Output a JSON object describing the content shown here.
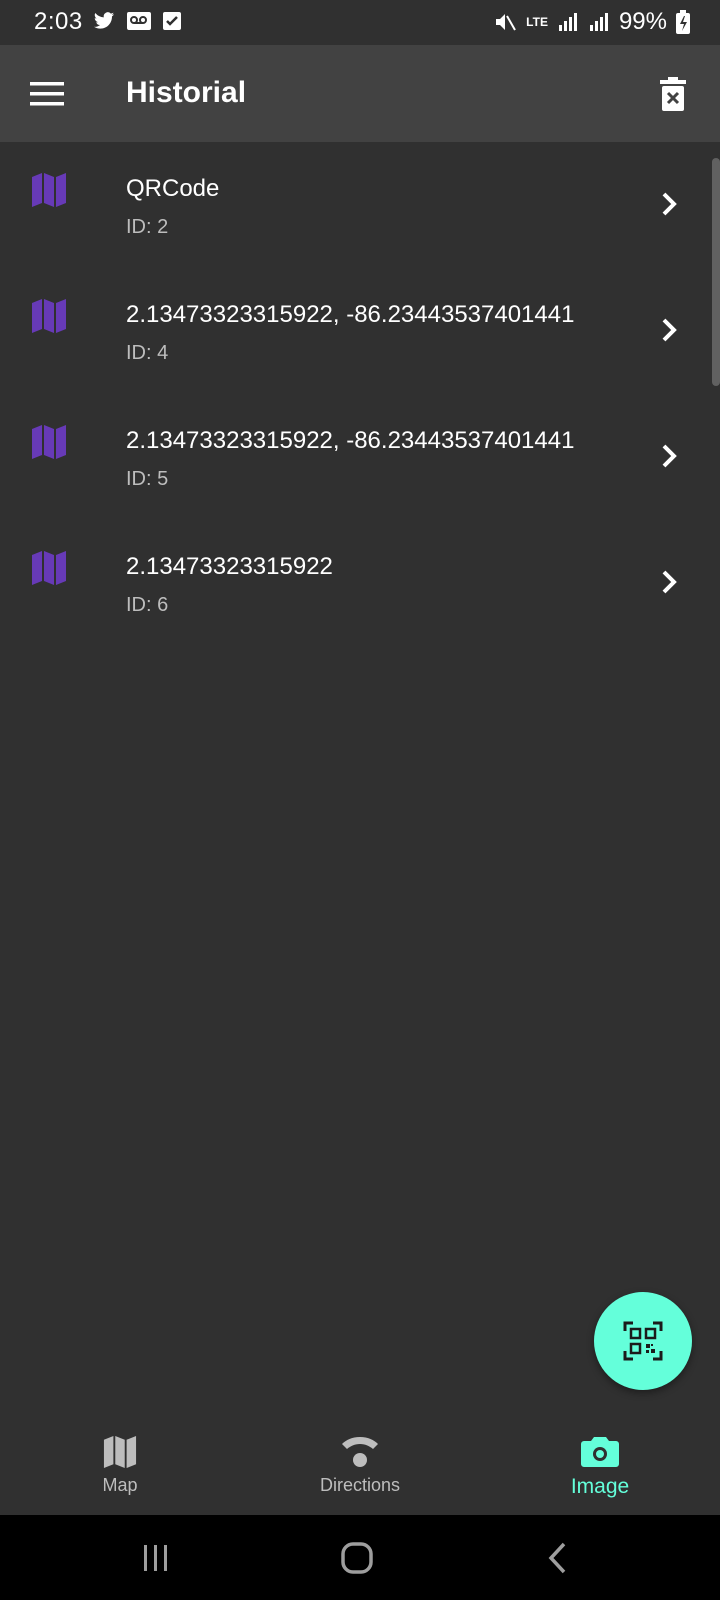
{
  "status_bar": {
    "time": "2:03",
    "battery": "99%",
    "network": "LTE"
  },
  "app_bar": {
    "title": "Historial",
    "menu_icon": "menu-icon",
    "delete_icon": "delete-sweep-icon"
  },
  "history": {
    "items": [
      {
        "title": "QRCode",
        "subtitle": "ID: 2"
      },
      {
        "title": "2.13473323315922, -86.23443537401441",
        "subtitle": "ID: 4"
      },
      {
        "title": "2.13473323315922, -86.23443537401441",
        "subtitle": "ID: 5"
      },
      {
        "title": "2.13473323315922",
        "subtitle": "ID: 6"
      }
    ],
    "item_icon": "map-icon",
    "item_icon_color": "#673ab7"
  },
  "fab": {
    "icon": "qr-scan-icon",
    "color": "#64ffda"
  },
  "bottom_nav": {
    "items": [
      {
        "label": "Map",
        "icon": "map-icon",
        "active": false
      },
      {
        "label": "Directions",
        "icon": "wifi-icon",
        "active": false
      },
      {
        "label": "Image",
        "icon": "camera-icon",
        "active": true
      }
    ],
    "active_color": "#64ffda"
  },
  "colors": {
    "background": "#303030",
    "app_bar": "#424242",
    "accent": "#64ffda",
    "icon_purple": "#673ab7"
  }
}
